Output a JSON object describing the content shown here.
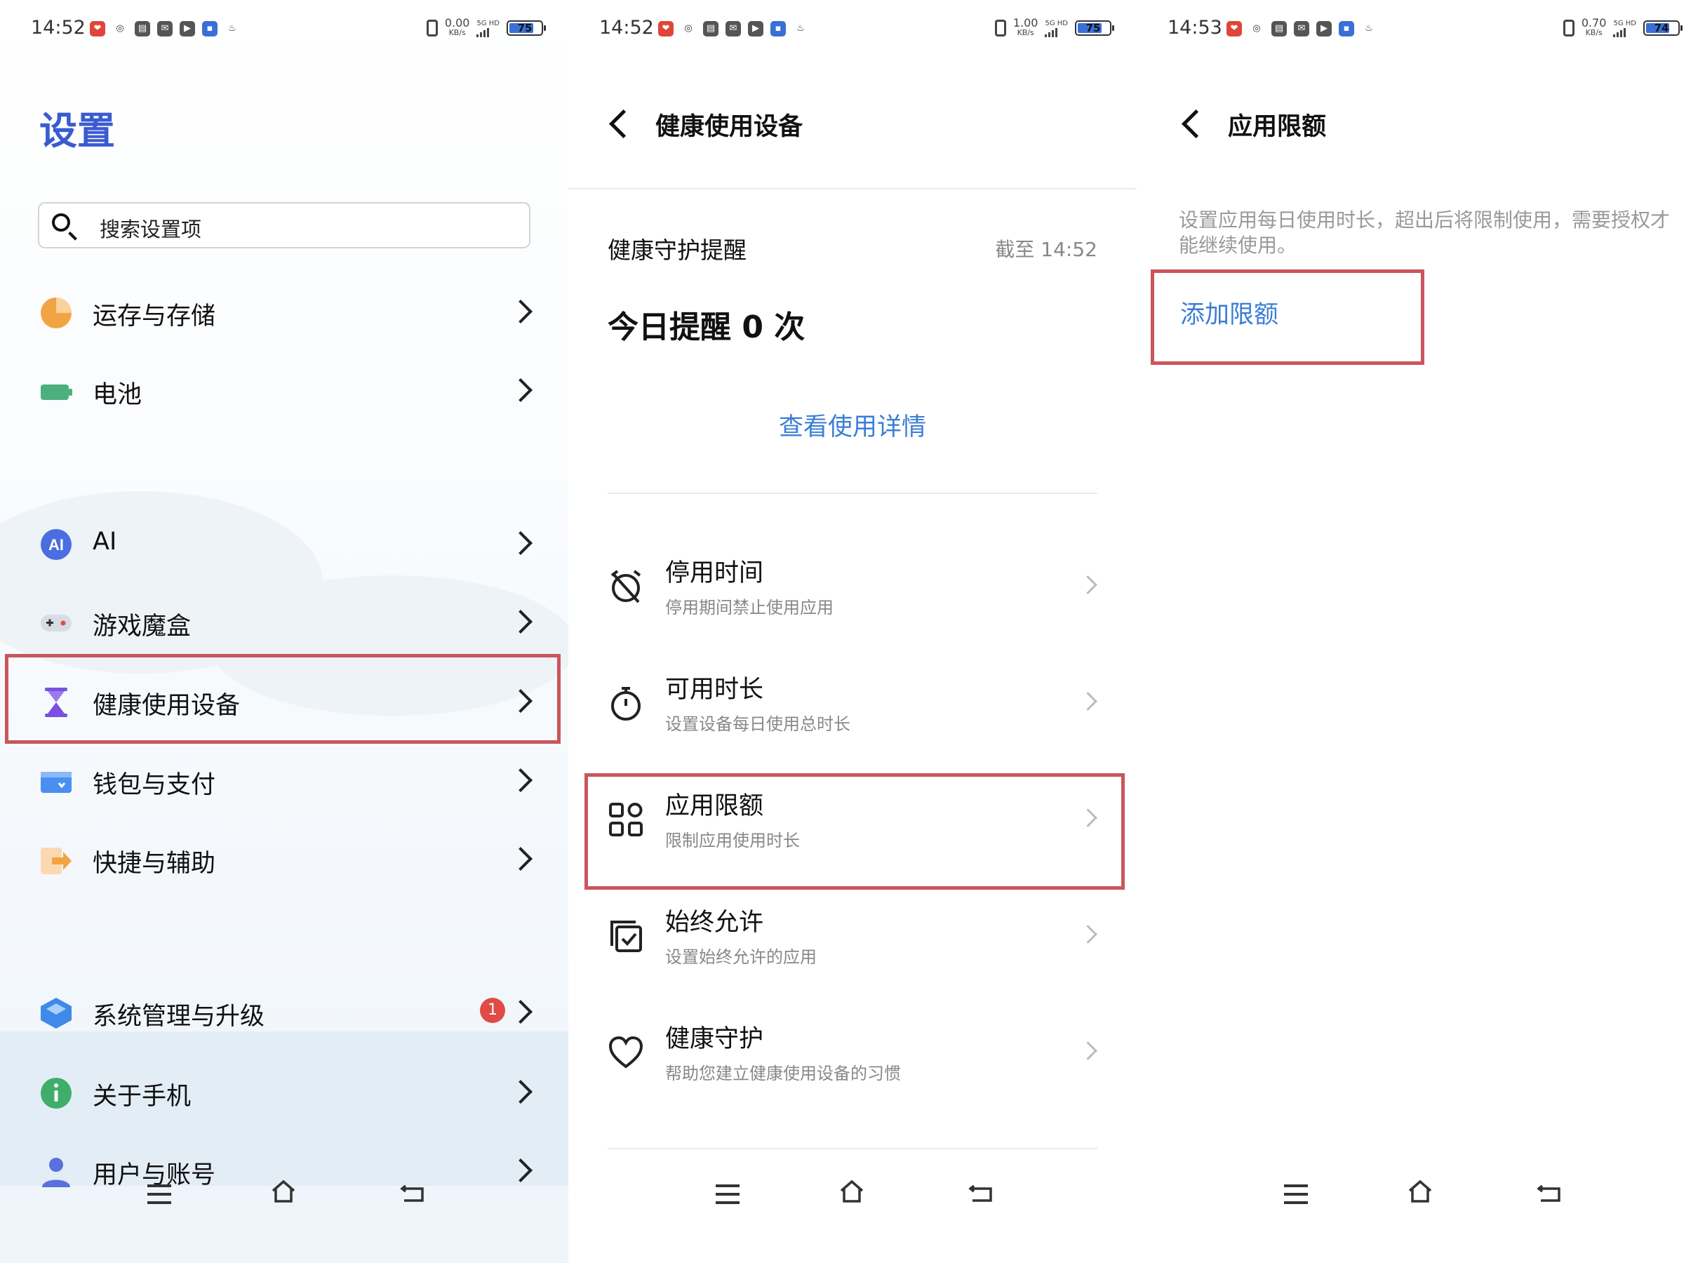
{
  "colors": {
    "accent_blue": "#3a7ed6",
    "title_blue": "#3a5bd0",
    "highlight_red": "#c9565c",
    "badge_red": "#e04b45"
  },
  "panel1": {
    "status": {
      "time": "14:52",
      "speed": "0.00",
      "speed_unit": "KB/s",
      "network": "5G HD",
      "battery": "75"
    },
    "title": "设置",
    "search": {
      "placeholder": "搜索设置项"
    },
    "items": [
      {
        "label": "运存与存储",
        "icon": "pie-chart-icon"
      },
      {
        "label": "电池",
        "icon": "battery-icon"
      },
      {
        "label": "AI",
        "icon": "ai-icon"
      },
      {
        "label": "游戏魔盒",
        "icon": "gamepad-icon"
      },
      {
        "label": "健康使用设备",
        "icon": "hourglass-icon"
      },
      {
        "label": "钱包与支付",
        "icon": "wallet-icon"
      },
      {
        "label": "快捷与辅助",
        "icon": "shortcut-arrow-icon"
      },
      {
        "label": "系统管理与升级",
        "icon": "layers-icon",
        "badge": "1"
      },
      {
        "label": "关于手机",
        "icon": "info-icon"
      },
      {
        "label": "用户与账号",
        "icon": "user-icon"
      }
    ]
  },
  "panel2": {
    "status": {
      "time": "14:52",
      "speed": "1.00",
      "speed_unit": "KB/s",
      "network": "5G HD",
      "battery": "75"
    },
    "header_title": "健康使用设备",
    "reminder_label": "健康守护提醒",
    "reminder_time": "截至 14:52",
    "reminder_count": "今日提醒 0 次",
    "view_details": "查看使用详情",
    "options": [
      {
        "title": "停用时间",
        "subtitle": "停用期间禁止使用应用",
        "icon": "alarm-off-icon"
      },
      {
        "title": "可用时长",
        "subtitle": "设置设备每日使用总时长",
        "icon": "stopwatch-icon"
      },
      {
        "title": "应用限额",
        "subtitle": "限制应用使用时长",
        "icon": "app-grid-icon"
      },
      {
        "title": "始终允许",
        "subtitle": "设置始终允许的应用",
        "icon": "check-stack-icon"
      },
      {
        "title": "健康守护",
        "subtitle": "帮助您建立健康使用设备的习惯",
        "icon": "heart-icon"
      }
    ]
  },
  "panel3": {
    "status": {
      "time": "14:53",
      "speed": "0.70",
      "speed_unit": "KB/s",
      "network": "5G HD",
      "battery": "74"
    },
    "header_title": "应用限额",
    "description": "设置应用每日使用时长，超出后将限制使用，需要授权才能继续使用。",
    "add_limit": "添加限额"
  }
}
